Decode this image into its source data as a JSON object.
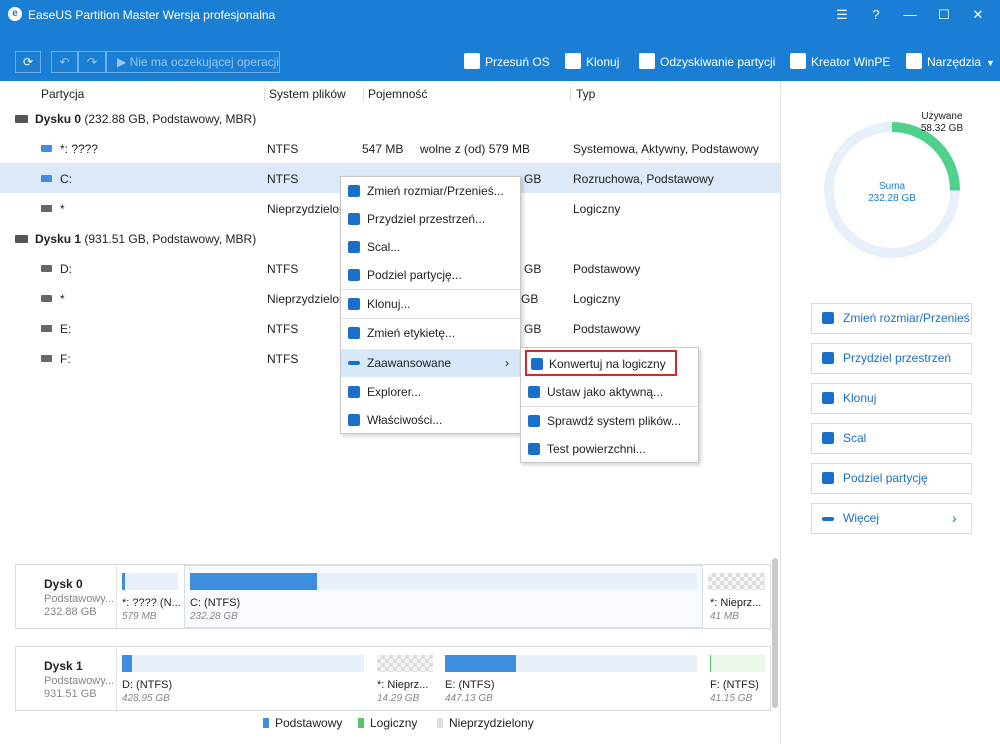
{
  "app": {
    "logo_glyph": "e",
    "title": "EaseUS Partition Master Wersja profesjonalna",
    "window_buttons": [
      "☰",
      "?",
      "—",
      "☐",
      "✕"
    ]
  },
  "toolbar": {
    "refresh": "⟳",
    "undo": "↶",
    "redo": "↷",
    "pending": "▶ Nie ma oczekującej operacji",
    "tools": [
      "Przesuń OS",
      "Klonuj",
      "Odzyskiwanie partycji",
      "Kreator WinPE",
      "Narzędzia"
    ]
  },
  "table": {
    "headers": [
      "Partycja",
      "System plików",
      "Pojemność",
      "Typ"
    ],
    "disk0": {
      "name": "Dysku 0",
      "info": " (232.88 GB, Podstawowy, MBR)"
    },
    "disk1": {
      "name": "Dysku 1",
      "info": " (931.51 GB, Podstawowy, MBR)"
    },
    "rows": [
      {
        "name": "*: ????",
        "fs": "NTFS",
        "size": "547 MB",
        "free": "wolne z (od) 579 MB",
        "type": "Systemowa, Aktywny, Podstawowy"
      },
      {
        "name": "C:",
        "fs": "NTFS",
        "size": "GB",
        "free": "",
        "type": "Rozruchowa, Podstawowy"
      },
      {
        "name": "*",
        "fs": "Nieprzydzielon",
        "size": "",
        "free": "",
        "type": "Logiczny"
      },
      {
        "name": "D:",
        "fs": "NTFS",
        "size": "GB",
        "free": "",
        "type": "Podstawowy"
      },
      {
        "name": "*",
        "fs": "Nieprzydzielon",
        "size": "GB",
        "free": "",
        "type": "Logiczny"
      },
      {
        "name": "E:",
        "fs": "NTFS",
        "size": "GB",
        "free": "",
        "type": "Podstawowy"
      },
      {
        "name": "F:",
        "fs": "NTFS",
        "size": "",
        "free": "",
        "type": ""
      }
    ]
  },
  "context_menu": {
    "items": [
      "Zmień rozmiar/Przenieś...",
      "Przydziel przestrzeń...",
      "Scal...",
      "Podziel partycję...",
      "Klonuj...",
      "Zmień etykietę...",
      "Zaawansowane",
      "Explorer...",
      "Właściwości..."
    ],
    "arrow": "›"
  },
  "submenu": {
    "items": [
      "Konwertuj na logiczny",
      "Ustaw jako aktywną...",
      "Sprawdź system plików...",
      "Test powierzchni..."
    ]
  },
  "right_panel": {
    "used_label": "Używane",
    "used_value": "58.32 GB",
    "total_label": "Suma",
    "total_value": "232.28 GB",
    "used_fraction": 0.251,
    "actions": [
      "Zmień rozmiar/Przenieś",
      "Przydziel przestrzeń",
      "Klonuj",
      "Scal",
      "Podziel partycję",
      "Więcej"
    ],
    "more_arrow": "›"
  },
  "disk_map": {
    "disk0": {
      "name": "Dysk 0",
      "type": "Podstawowy...",
      "size": "232.88 GB",
      "parts": [
        {
          "label": "*: ???? (N...",
          "size": "579 MB",
          "fill": 0.05
        },
        {
          "label": "C:  (NTFS)",
          "size": "232.28 GB",
          "fill": 0.25
        },
        {
          "label": "*: Nieprz...",
          "size": "41 MB",
          "fill": 0
        }
      ]
    },
    "disk1": {
      "name": "Dysk 1",
      "type": "Podstawowy...",
      "size": "931.51 GB",
      "parts": [
        {
          "label": "D:  (NTFS)",
          "size": "428.95 GB",
          "fill": 0.04
        },
        {
          "label": "*: Nieprz...",
          "size": "14.29 GB",
          "fill": 0
        },
        {
          "label": "E:  (NTFS)",
          "size": "447.13 GB",
          "fill": 0.28
        },
        {
          "label": "F:  (NTFS)",
          "size": "41.15 GB",
          "fill": 0.02
        }
      ]
    }
  },
  "legend": [
    "Podstawowy",
    "Logiczny",
    "Nieprzydzielony"
  ],
  "colors": {
    "accent": "#1a7fd4",
    "primary": "#3d8ee0",
    "logical": "#59c26b",
    "used_ring": "#4fd18b",
    "highlight": "#d9262c"
  }
}
